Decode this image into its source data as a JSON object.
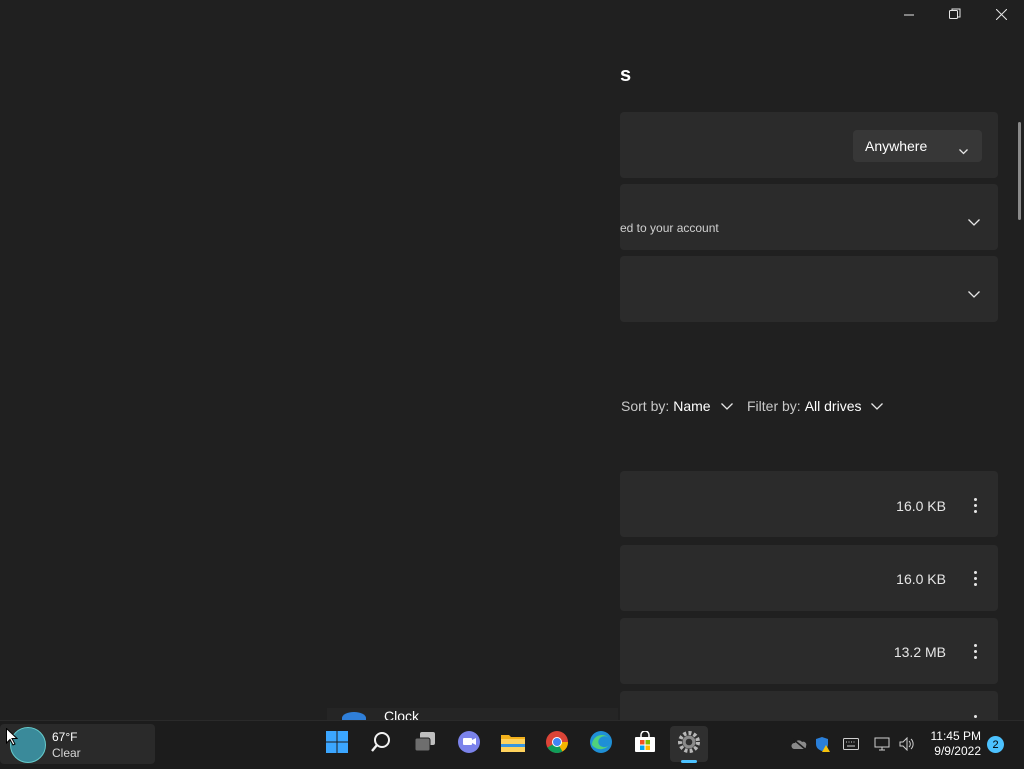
{
  "window": {
    "heading_fragment": "s",
    "minimize_icon": "minimize-icon",
    "maximize_icon": "restore-icon",
    "close_icon": "close-icon"
  },
  "settings": {
    "install_location_dropdown": "Anywhere",
    "sharing_subtext": "ed to your account",
    "sort_label": "Sort by:",
    "sort_value": "Name",
    "filter_label": "Filter by:",
    "filter_value": "All drives"
  },
  "apps": [
    {
      "size": "16.0 KB"
    },
    {
      "size": "16.0 KB"
    },
    {
      "size": "13.2 MB"
    }
  ],
  "partial_app": {
    "name": "Clock"
  },
  "taskbar": {
    "weather_temp": "67°F",
    "weather_cond": "Clear",
    "time": "11:45 PM",
    "date": "9/9/2022",
    "notification_count": "2",
    "pinned": [
      "start-icon",
      "search-icon",
      "task-view-icon",
      "teams-chat-icon",
      "file-explorer-icon",
      "chrome-icon",
      "edge-icon",
      "store-icon",
      "settings-icon"
    ],
    "accent": "#4cc2ff"
  }
}
